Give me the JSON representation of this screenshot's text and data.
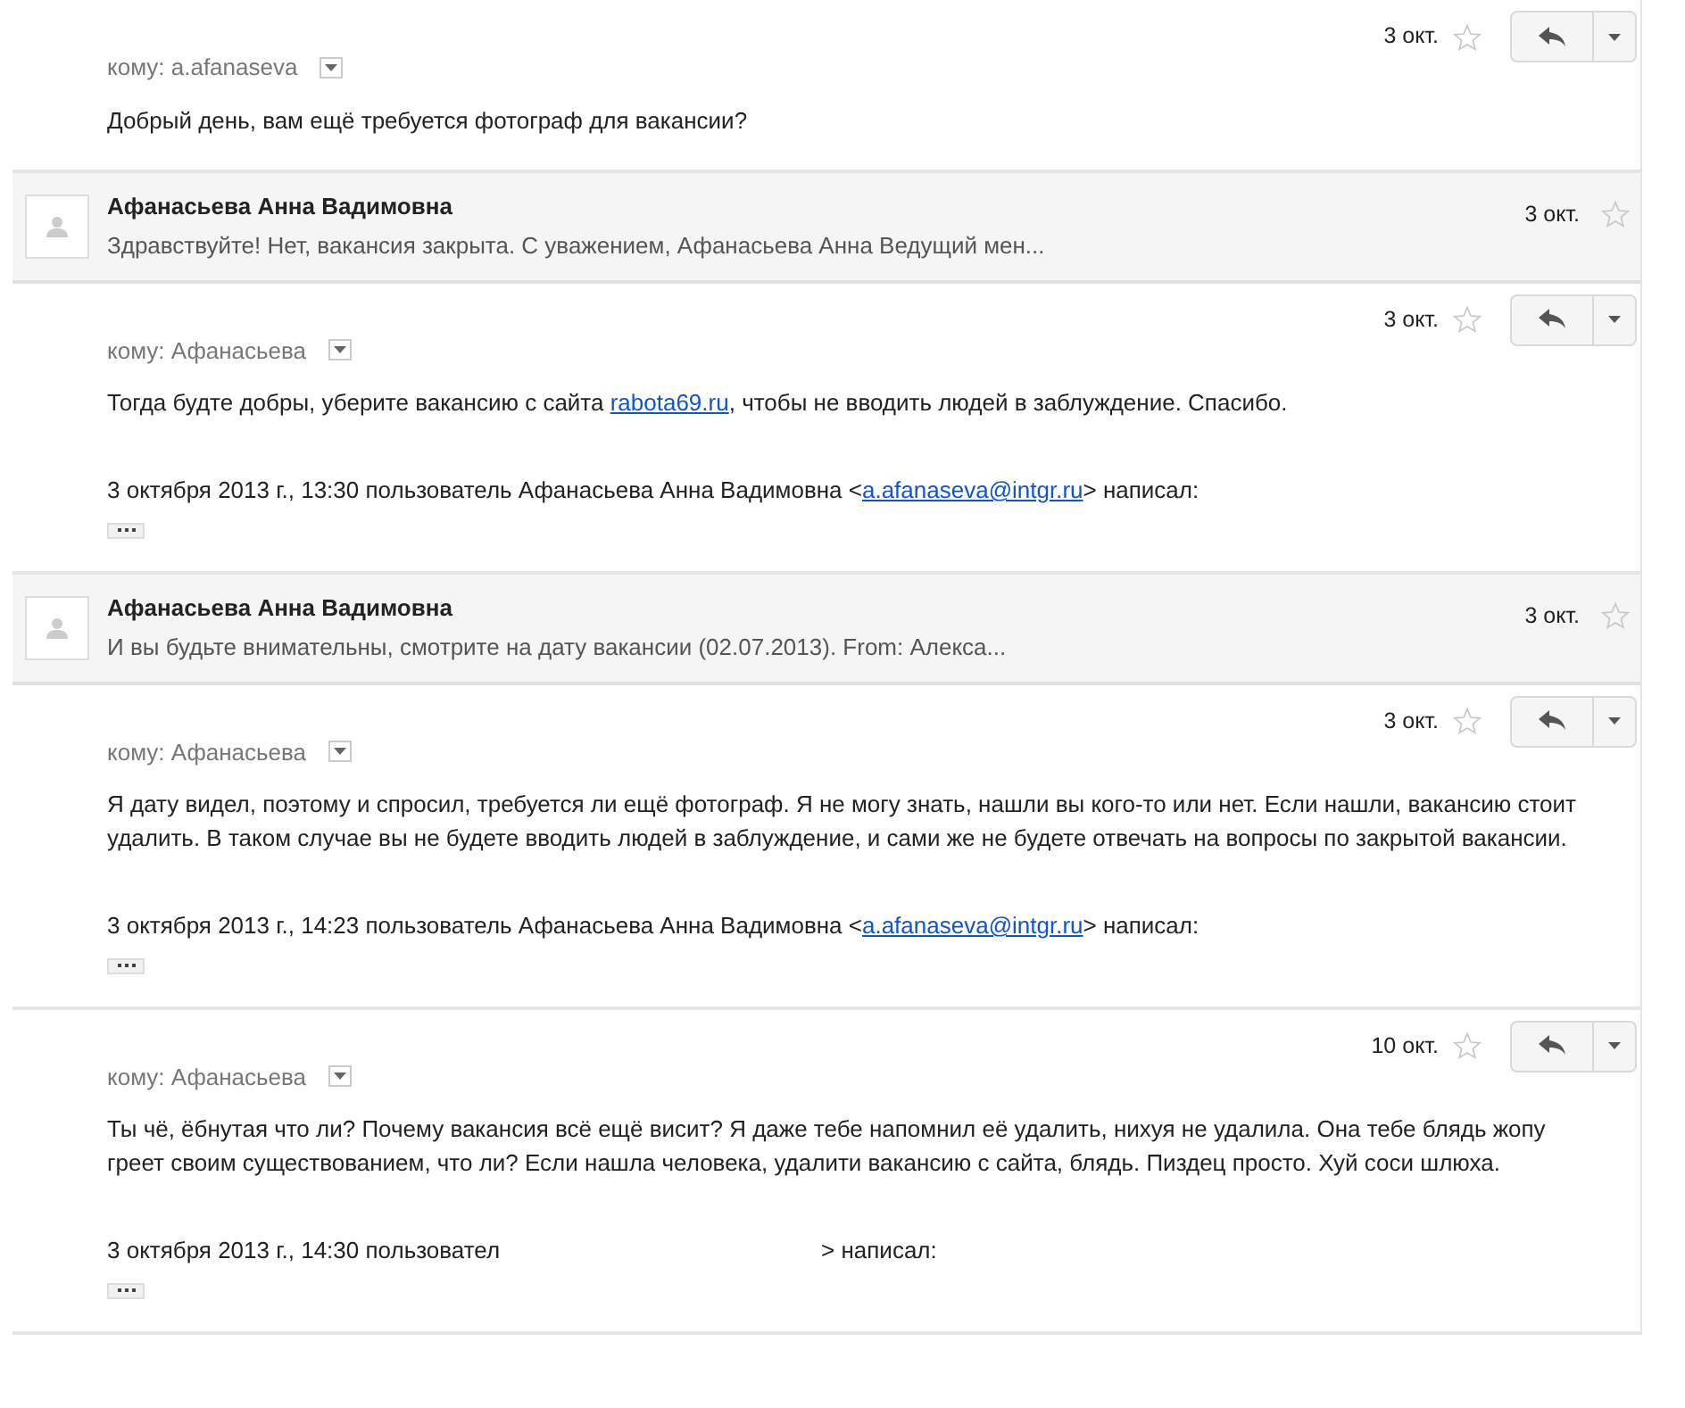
{
  "messages": [
    {
      "kind": "expanded",
      "date": "3 окт.",
      "starred": false,
      "to": "кому: a.afanaseva",
      "body": [
        {
          "kind": "text",
          "text": "Добрый день, вам ещё требуется фотограф для вакансии?"
        }
      ]
    },
    {
      "kind": "collapsed",
      "sender": "Афанасьева Анна Вадимовна",
      "snippet": "Здравствуйте! Нет, вакансия закрыта. С уважением, Афанасьева Анна Ведущий мен...",
      "date": "3 окт.",
      "starred": false
    },
    {
      "kind": "expanded",
      "date": "3 окт.",
      "starred": false,
      "to": "кому: Афанасьева",
      "body": [
        {
          "kind": "text",
          "text": "Тогда будте добры, уберите вакансию с сайта "
        },
        {
          "kind": "link",
          "text": "rabota69.ru"
        },
        {
          "kind": "text",
          "text": ", чтобы не вводить людей в заблуждение. Спасибо."
        }
      ],
      "quote": {
        "prefix": "3 октября 2013 г., 13:30 пользователь Афанасьева Анна Вадимовна <",
        "link": "a.afanaseva@intgr.ru",
        "suffix": "> написал:"
      }
    },
    {
      "kind": "collapsed",
      "sender": "Афанасьева Анна Вадимовна",
      "snippet": "И вы будьте внимательны, смотрите на дату вакансии (02.07.2013). From: Алекса...",
      "date": "3 окт.",
      "starred": false
    },
    {
      "kind": "expanded",
      "date": "3 окт.",
      "starred": false,
      "to": "кому: Афанасьева",
      "body": [
        {
          "kind": "text",
          "text": "Я дату видел, поэтому и спросил, требуется ли ещё фотограф. Я не могу знать, нашли вы кого-то или нет. Если нашли, вакансию стоит удалить. В таком случае вы не будете вводить людей в заблуждение, и сами же не будете отвечать на вопросы по закрытой вакансии."
        }
      ],
      "quote": {
        "prefix": "3 октября 2013 г., 14:23 пользователь Афанасьева Анна Вадимовна <",
        "link": "a.afanaseva@intgr.ru",
        "suffix": "> написал:"
      }
    },
    {
      "kind": "expanded",
      "date": "10 окт.",
      "starred": false,
      "to": "кому: Афанасьева",
      "body": [
        {
          "kind": "text",
          "text": "Ты чё, ёбнутая что ли? Почему вакансия всё ещё висит? Я даже тебе напомнил её удалить, нихуя не удалила. Она тебе блядь жопу греет своим существованием, что ли? Если нашла человека, удалити вакансию с сайта, блядь. Пиздец просто. Хуй соси шлюха."
        }
      ],
      "quote": {
        "prefix": "3 октября 2013 г., 14:30 пользовател",
        "suffix": "> написал:"
      }
    }
  ]
}
